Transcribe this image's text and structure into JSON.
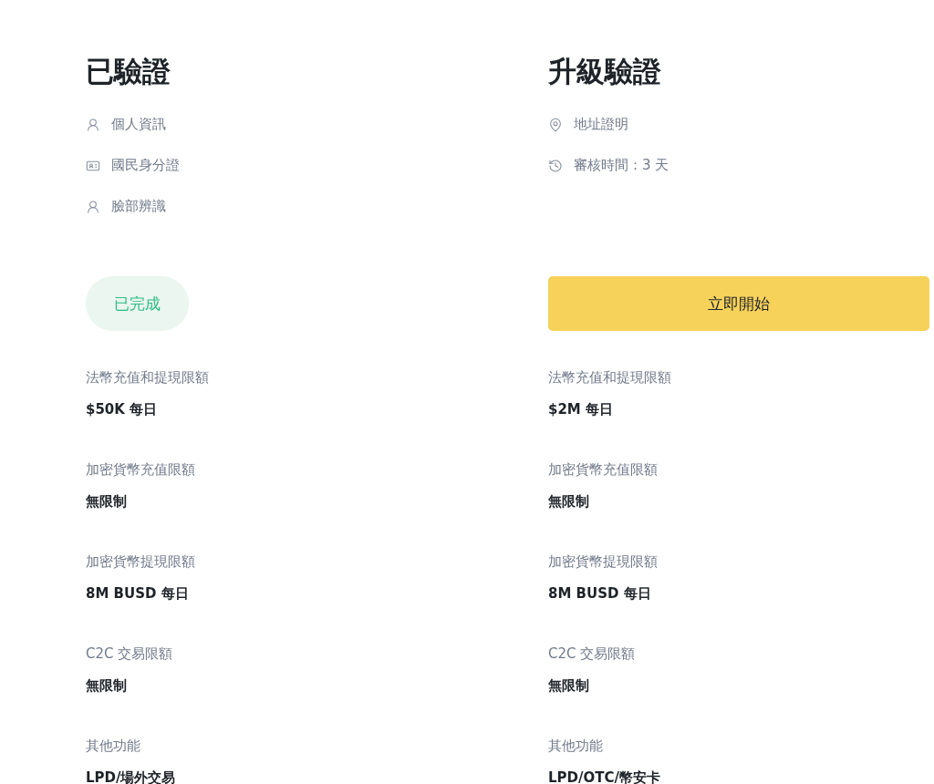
{
  "columns": [
    {
      "title": "已驗證",
      "features": [
        {
          "kind": "profile",
          "label": "個人資訊"
        },
        {
          "kind": "id-card",
          "label": "國民身分證"
        },
        {
          "kind": "person",
          "label": "臉部辨識"
        }
      ],
      "status": {
        "kind": "done",
        "label": "已完成"
      },
      "limits": [
        {
          "label": "法幣充值和提現限額",
          "value": "$50K 每日"
        },
        {
          "label": "加密貨幣充值限額",
          "value": "無限制"
        },
        {
          "label": "加密貨幣提現限額",
          "value": "8M BUSD 每日"
        },
        {
          "label": "C2C 交易限額",
          "value": "無限制"
        },
        {
          "label": "其他功能",
          "value": "LPD/場外交易"
        }
      ]
    },
    {
      "title": "升級驗證",
      "features": [
        {
          "kind": "location",
          "label": "地址證明"
        },
        {
          "kind": "clock",
          "label": "審核時間：3 天"
        }
      ],
      "status": {
        "kind": "action",
        "label": "立即開始"
      },
      "limits": [
        {
          "label": "法幣充值和提現限額",
          "value": "$2M 每日"
        },
        {
          "label": "加密貨幣充值限額",
          "value": "無限制"
        },
        {
          "label": "加密貨幣提現限額",
          "value": "8M BUSD 每日"
        },
        {
          "label": "C2C 交易限額",
          "value": "無限制"
        },
        {
          "label": "其他功能",
          "value": "LPD/OTC/幣安卡"
        }
      ]
    }
  ]
}
